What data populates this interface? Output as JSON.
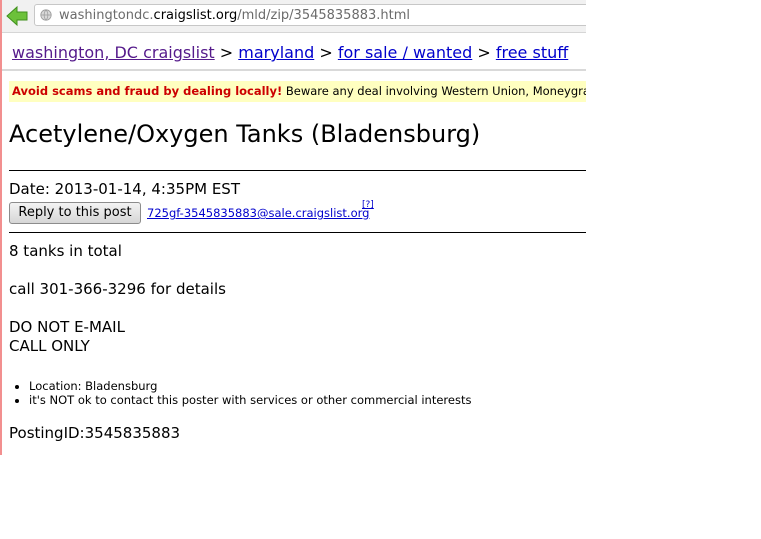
{
  "browser": {
    "url_prefix": "washingtondc.",
    "url_domain": "craigslist.org",
    "url_path": "/mld/zip/3545835883.html"
  },
  "breadcrumb": {
    "items": [
      "washington, DC craigslist",
      "maryland",
      "for sale / wanted",
      "free stuff"
    ],
    "separator": ">"
  },
  "scam_notice": {
    "warning": "Avoid scams and fraud by dealing locally!",
    "text": " Beware any deal involving Western Union, Moneygram, wire transfer"
  },
  "post": {
    "title": "Acetylene/Oxygen Tanks (Bladensburg)",
    "date": "Date: 2013-01-14, 4:35PM EST",
    "reply_label": "Reply to this post",
    "email": "725gf-3545835883@sale.craigslist.org",
    "help": "[?]",
    "body": [
      "8 tanks in total",
      "call 301-366-3296 for details",
      "DO NOT E-MAIL",
      "CALL ONLY"
    ],
    "attributes": [
      "Location: Bladensburg",
      "it's NOT ok to contact this poster with services or other commercial interests"
    ],
    "posting_id": "PostingID:3545835883"
  },
  "colors": {
    "link": "#0000cc",
    "visited": "#551a8b",
    "warning": "#cc0000",
    "notice_bg": "#ffffc0"
  }
}
